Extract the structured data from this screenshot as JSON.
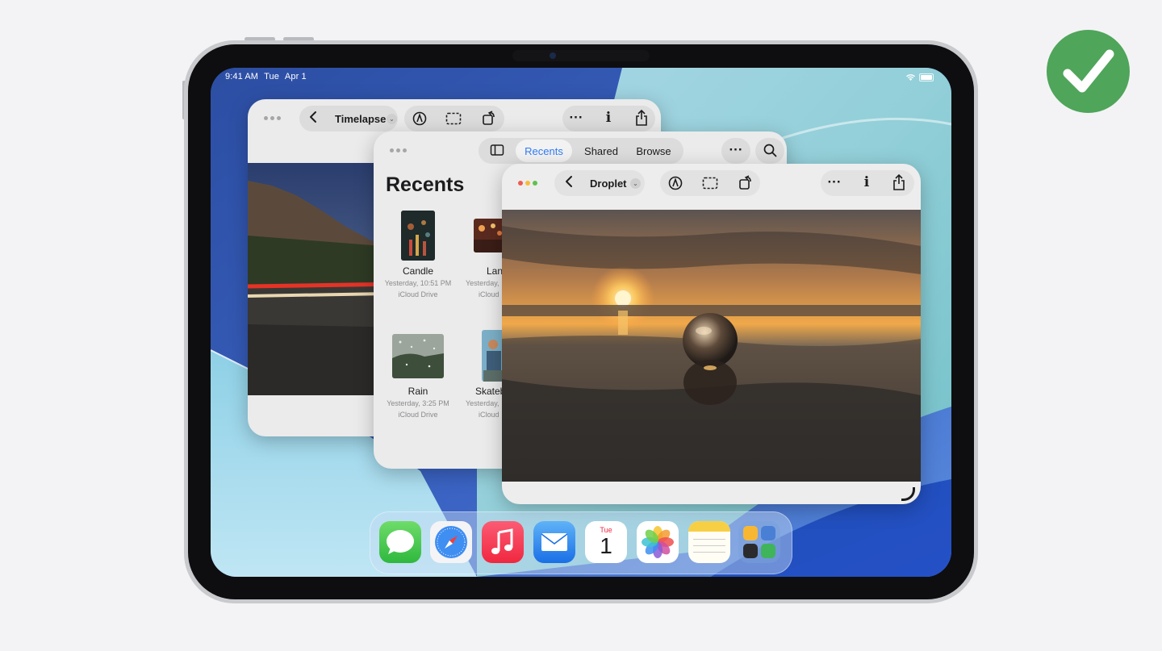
{
  "status_bar": {
    "time": "9:41 AM",
    "day": "Tue",
    "date": "Apr 1"
  },
  "timelapse_window": {
    "title": "Timelapse"
  },
  "files_window": {
    "tabs": [
      "Recents",
      "Shared",
      "Browse"
    ],
    "active_tab": "Recents",
    "heading": "Recents",
    "files": [
      {
        "name": "Candle",
        "date": "Yesterday, 10:51 PM",
        "location": "iCloud Drive"
      },
      {
        "name": "Lan",
        "date": "Yesterday,",
        "location": "iCloud"
      },
      {
        "name": "Rain",
        "date": "Yesterday, 3:25 PM",
        "location": "iCloud Drive"
      },
      {
        "name": "Skateb",
        "date": "Yesterday,",
        "location": "iCloud"
      }
    ]
  },
  "droplet_window": {
    "title": "Droplet"
  },
  "dock": {
    "apps": [
      "Messages",
      "Safari",
      "Music",
      "Mail",
      "Calendar",
      "Photos",
      "Notes",
      "App Library"
    ],
    "calendar_day": "Tue",
    "calendar_date": "1"
  },
  "colors": {
    "accent": "#2f7cf6",
    "check": "#4fa55a"
  }
}
